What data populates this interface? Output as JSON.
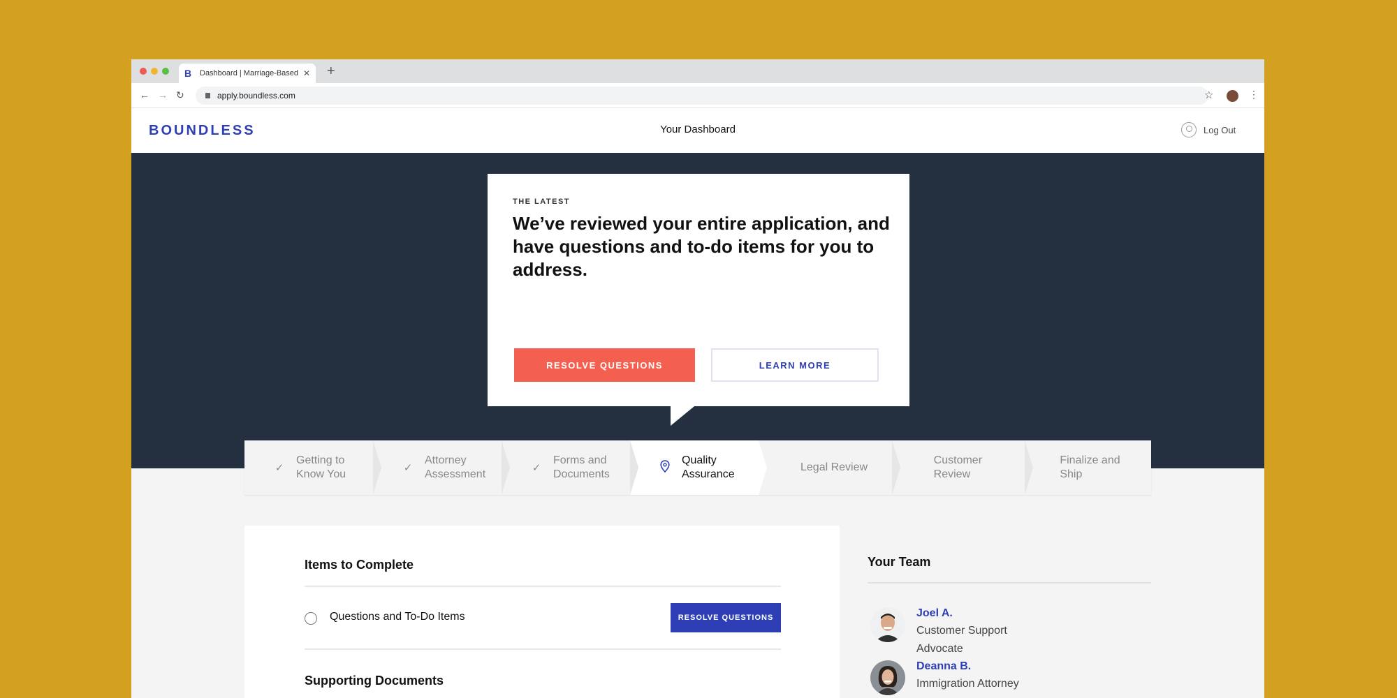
{
  "browser": {
    "tab_title": "Dashboard | Marriage-Based Green",
    "tab_favicon": "B",
    "new_tab": "+",
    "url": "apply.boundless.com"
  },
  "header": {
    "logo": "BOUNDLESS",
    "title": "Your Dashboard",
    "logout": "Log Out"
  },
  "hero": {
    "eyebrow": "THE LATEST",
    "headline": "We’ve reviewed your entire application, and have questions and to-do items for you to address.",
    "primary_button": "RESOLVE QUESTIONS",
    "secondary_button": "LEARN MORE"
  },
  "steps": [
    {
      "label": "Getting to Know You",
      "status": "complete",
      "icon": "check-icon"
    },
    {
      "label": "Attorney Assessment",
      "status": "complete",
      "icon": "check-icon"
    },
    {
      "label": "Forms and Documents",
      "status": "complete",
      "icon": "check-icon"
    },
    {
      "label": "Quality Assurance",
      "status": "current",
      "icon": "location-pin-icon"
    },
    {
      "label": "Legal Review",
      "status": "upcoming"
    },
    {
      "label": "Customer Review",
      "status": "upcoming"
    },
    {
      "label": "Finalize and Ship",
      "status": "upcoming"
    }
  ],
  "items": {
    "title": "Items to Complete",
    "rows": [
      {
        "label": "Questions and To-Do Items",
        "button": "RESOLVE QUESTIONS"
      }
    ],
    "supporting_title": "Supporting Documents"
  },
  "team": {
    "title": "Your Team",
    "members": [
      {
        "name": "Joel A.",
        "role": "Customer Support Advocate"
      },
      {
        "name": "Deanna B.",
        "role": "Immigration Attorney"
      }
    ]
  },
  "colors": {
    "page_bg": "#d4a020",
    "brand": "#2e3fb5",
    "hero_bg": "#242f40",
    "cta": "#f4604f"
  }
}
